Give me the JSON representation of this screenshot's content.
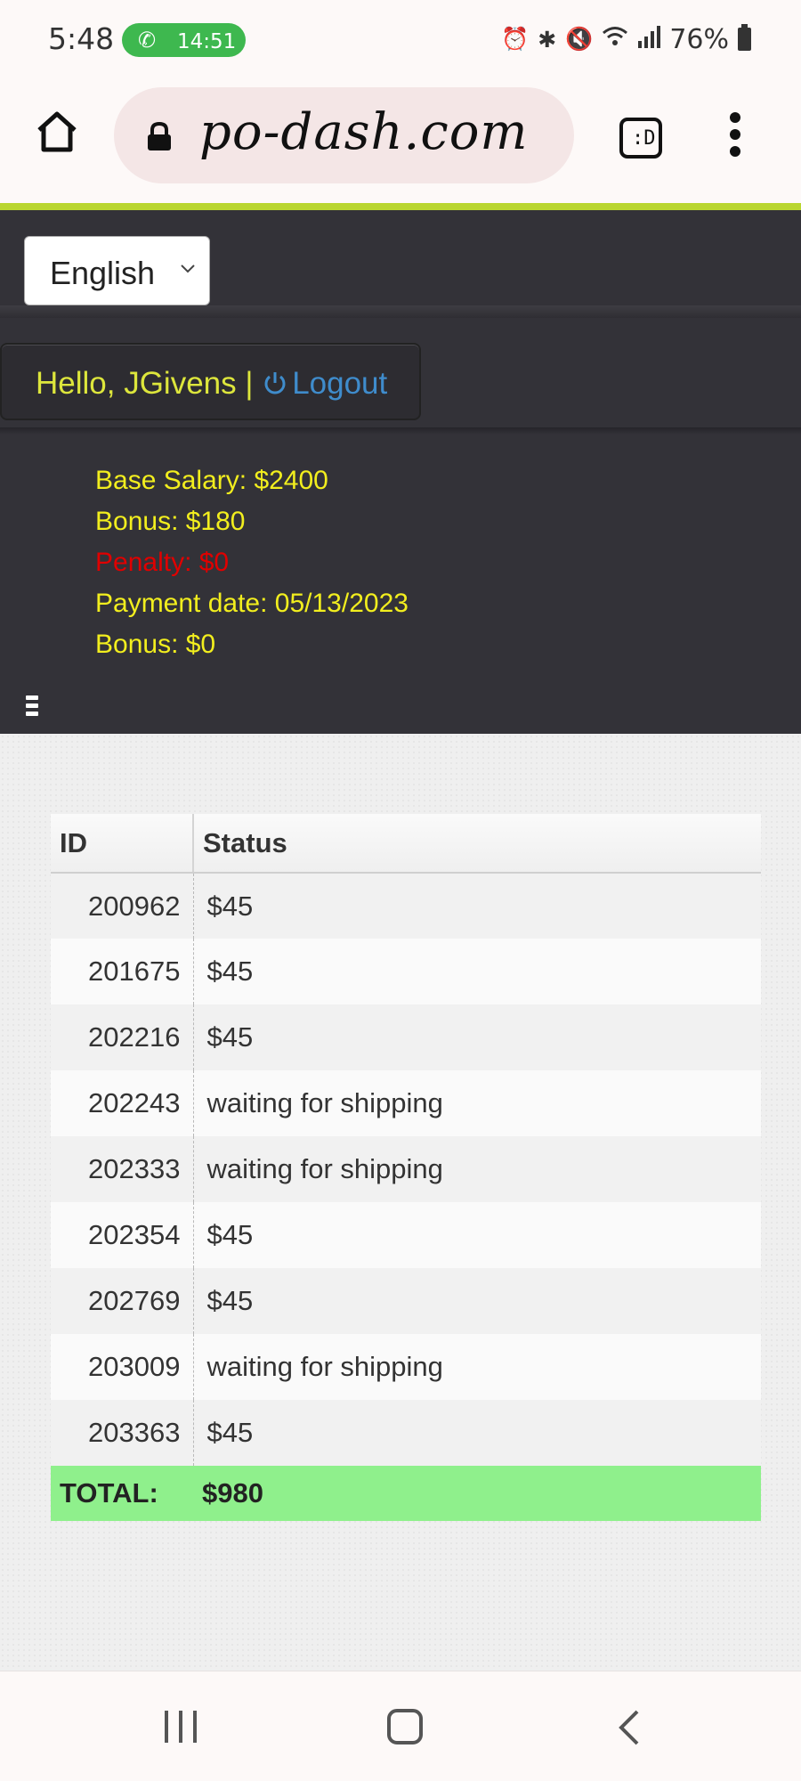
{
  "status_bar": {
    "time": "5:48",
    "call_time": "14:51",
    "battery": "76%",
    "icons": [
      "alarm-icon",
      "bluetooth-icon",
      "mute-icon",
      "wifi-icon",
      "signal-icon",
      "battery-icon"
    ]
  },
  "browser": {
    "url": "po-dash.com",
    "tab_icon_label": ":D"
  },
  "header": {
    "language": "English",
    "greeting": "Hello, JGivens |",
    "logout_label": "Logout",
    "accent_color": "#b9d630"
  },
  "info": [
    {
      "key": "Base Salary:",
      "value": "$2400"
    },
    {
      "key": "Bonus:",
      "value": "$180"
    },
    {
      "key": "Penalty:",
      "value": "$0"
    },
    {
      "key": "Payment date:",
      "value": "05/13/2023"
    },
    {
      "key": "Bonus:",
      "value": "$0"
    }
  ],
  "table": {
    "columns": [
      "ID",
      "Status"
    ],
    "rows": [
      {
        "id": "200962",
        "status": "$45"
      },
      {
        "id": "201675",
        "status": "$45"
      },
      {
        "id": "202216",
        "status": "$45"
      },
      {
        "id": "202243",
        "status": "waiting for shipping"
      },
      {
        "id": "202333",
        "status": "waiting for shipping"
      },
      {
        "id": "202354",
        "status": "$45"
      },
      {
        "id": "202769",
        "status": "$45"
      },
      {
        "id": "203009",
        "status": "waiting for shipping"
      },
      {
        "id": "203363",
        "status": "$45"
      }
    ],
    "total_label": "TOTAL:",
    "total_value": "$980",
    "total_color": "#8ff08c"
  }
}
